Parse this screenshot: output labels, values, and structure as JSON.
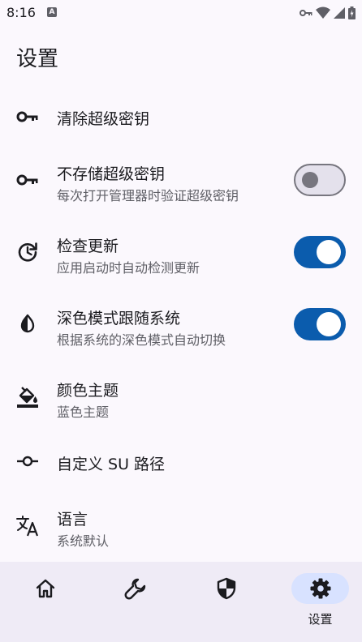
{
  "status_bar": {
    "time": "8:16",
    "notification_icon": "a-icon",
    "icons": [
      "key-icon",
      "wifi-icon",
      "signal-icon",
      "battery-icon"
    ]
  },
  "page": {
    "title": "设置"
  },
  "settings": [
    {
      "icon": "key-icon",
      "title": "清除超级密钥",
      "subtitle": ""
    },
    {
      "icon": "key-icon",
      "title": "不存储超级密钥",
      "subtitle": "每次打开管理器时验证超级密钥",
      "toggle": false
    },
    {
      "icon": "update-icon",
      "title": "检查更新",
      "subtitle": "应用启动时自动检测更新",
      "toggle": true
    },
    {
      "icon": "contrast-icon",
      "title": "深色模式跟随系统",
      "subtitle": "根据系统的深色模式自动切换",
      "toggle": true
    },
    {
      "icon": "format-color-fill-icon",
      "title": "颜色主题",
      "subtitle": "蓝色主题"
    },
    {
      "icon": "commit-icon",
      "title": "自定义 SU 路径",
      "subtitle": ""
    },
    {
      "icon": "translate-icon",
      "title": "语言",
      "subtitle": "系统默认"
    }
  ],
  "bottom_nav": {
    "items": [
      {
        "icon": "home-icon",
        "label": "",
        "active": false
      },
      {
        "icon": "wrench-icon",
        "label": "",
        "active": false
      },
      {
        "icon": "shield-icon",
        "label": "",
        "active": false
      },
      {
        "icon": "gear-icon",
        "label": "设置",
        "active": true
      }
    ]
  },
  "colors": {
    "background": "#fbf8fd",
    "accent": "#0b5cad",
    "nav_background": "#efebf6",
    "nav_active_indicator": "#d8e2ff",
    "secondary_text": "#5f5f66"
  }
}
